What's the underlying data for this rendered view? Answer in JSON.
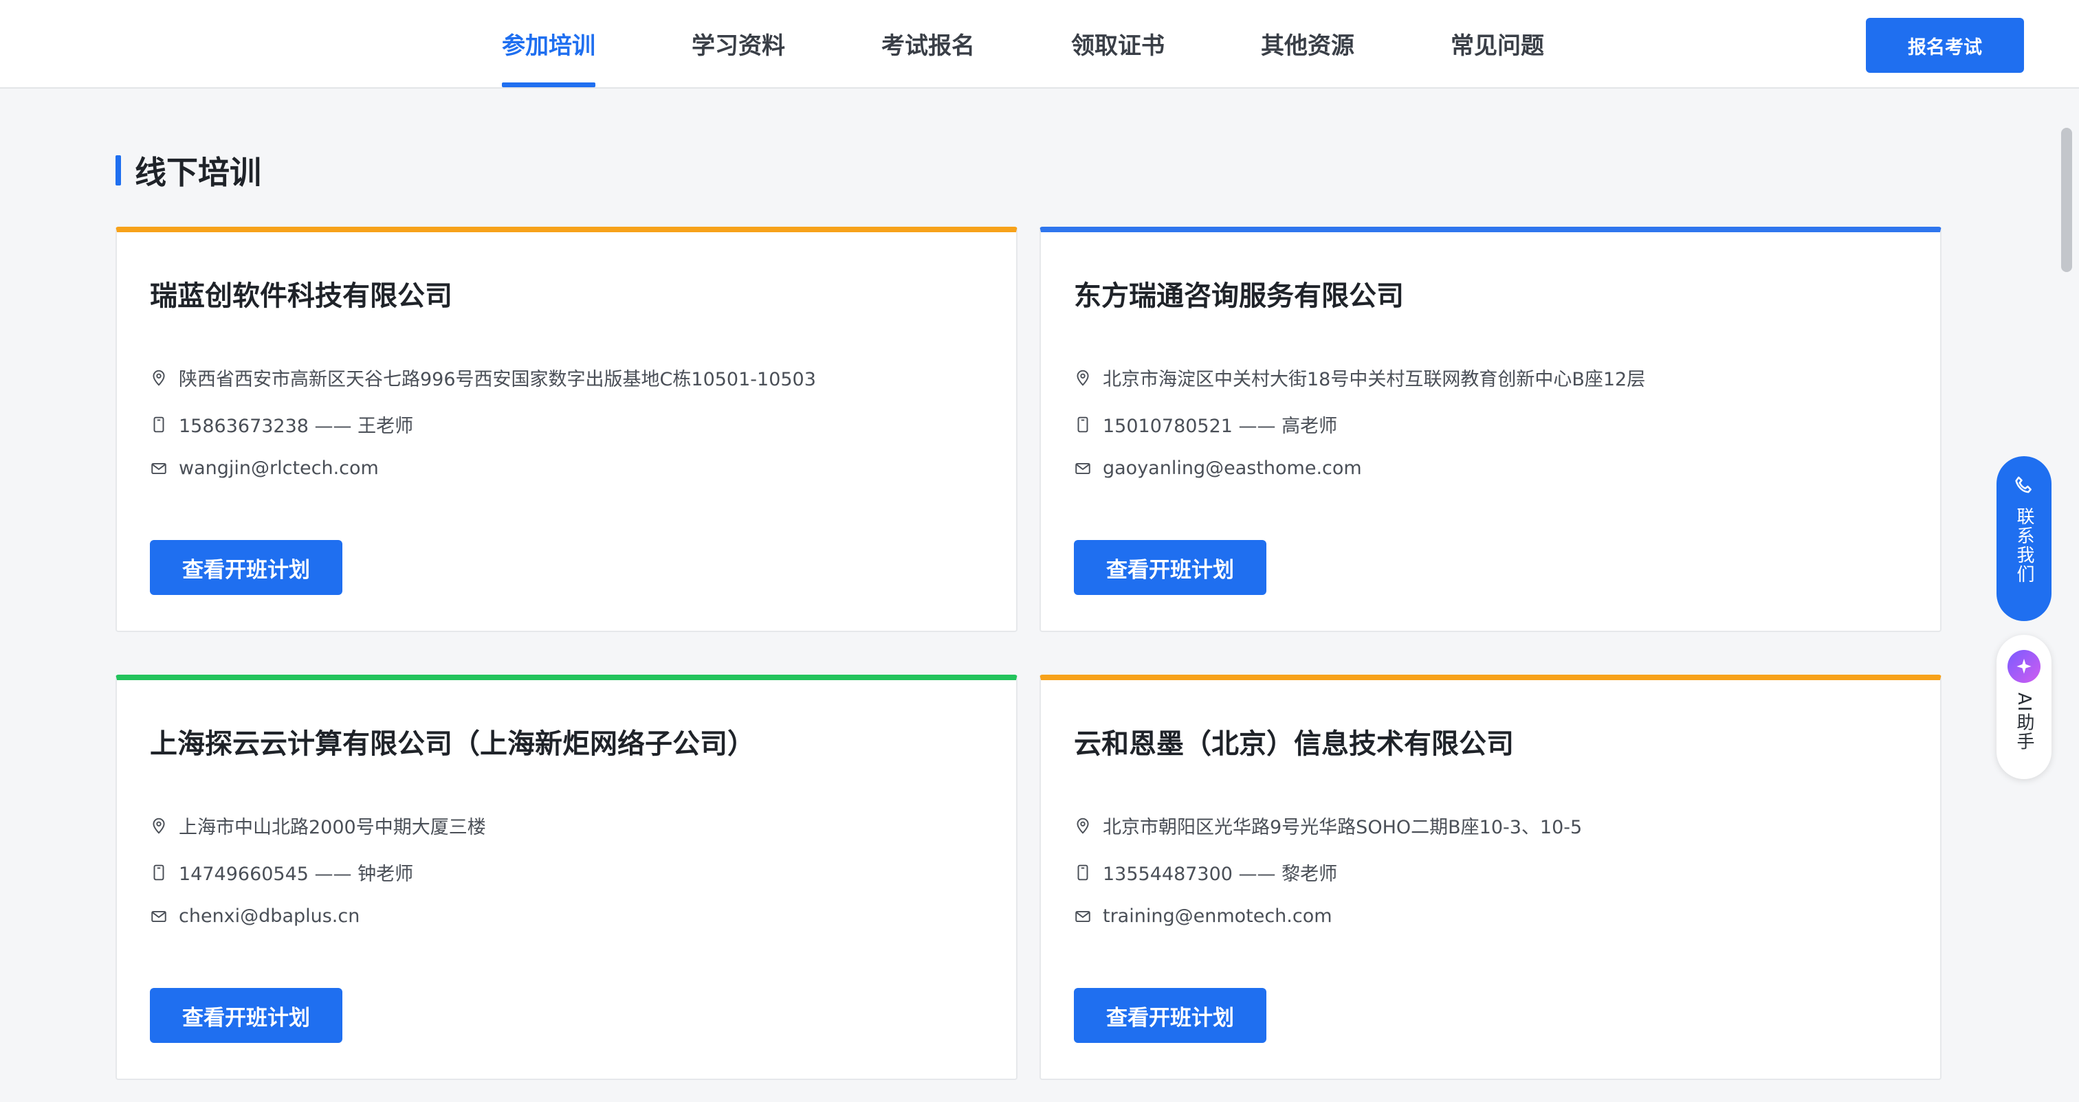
{
  "nav": {
    "tabs": [
      {
        "label": "参加培训",
        "active": true
      },
      {
        "label": "学习资料"
      },
      {
        "label": "考试报名"
      },
      {
        "label": "领取证书"
      },
      {
        "label": "其他资源"
      },
      {
        "label": "常见问题"
      }
    ],
    "signup_label": "报名考试"
  },
  "section": {
    "title": "线下培训"
  },
  "cards": [
    {
      "accent": "#f7a21a",
      "title": "瑞蓝创软件科技有限公司",
      "address": "陕西省西安市高新区天谷七路996号西安国家数字出版基地C栋10501-10503",
      "phone": "15863673238 —— 王老师",
      "email": "wangjin@rlctech.com",
      "button": "查看开班计划"
    },
    {
      "accent": "#2f76ee",
      "title": "东方瑞通咨询服务有限公司",
      "address": "北京市海淀区中关村大街18号中关村互联网教育创新中心B座12层",
      "phone": "15010780521 —— 高老师",
      "email": "gaoyanling@easthome.com",
      "button": "查看开班计划"
    },
    {
      "accent": "#23c35c",
      "title": "上海探云云计算有限公司（上海新炬网络子公司）",
      "address": "上海市中山北路2000号中期大厦三楼",
      "phone": "14749660545 —— 钟老师",
      "email": "chenxi@dbaplus.cn",
      "button": "查看开班计划"
    },
    {
      "accent": "#f7a21a",
      "title": "云和恩墨（北京）信息技术有限公司",
      "address": "北京市朝阳区光华路9号光华路SOHO二期B座10-3、10-5",
      "phone": "13554487300 —— 黎老师",
      "email": "training@enmotech.com",
      "button": "查看开班计划"
    }
  ],
  "float": {
    "contact_label": "联系我们",
    "ai_label": "AI助手"
  },
  "colors": {
    "primary": "#1f6ff0",
    "orange": "#f7a21a",
    "blue": "#2f76ee",
    "green": "#23c35c"
  },
  "icons": {
    "address": "location-pin-icon",
    "phone": "phone-icon",
    "email": "mail-icon",
    "contact": "phone-handset-icon",
    "ai": "sparkle-icon"
  }
}
